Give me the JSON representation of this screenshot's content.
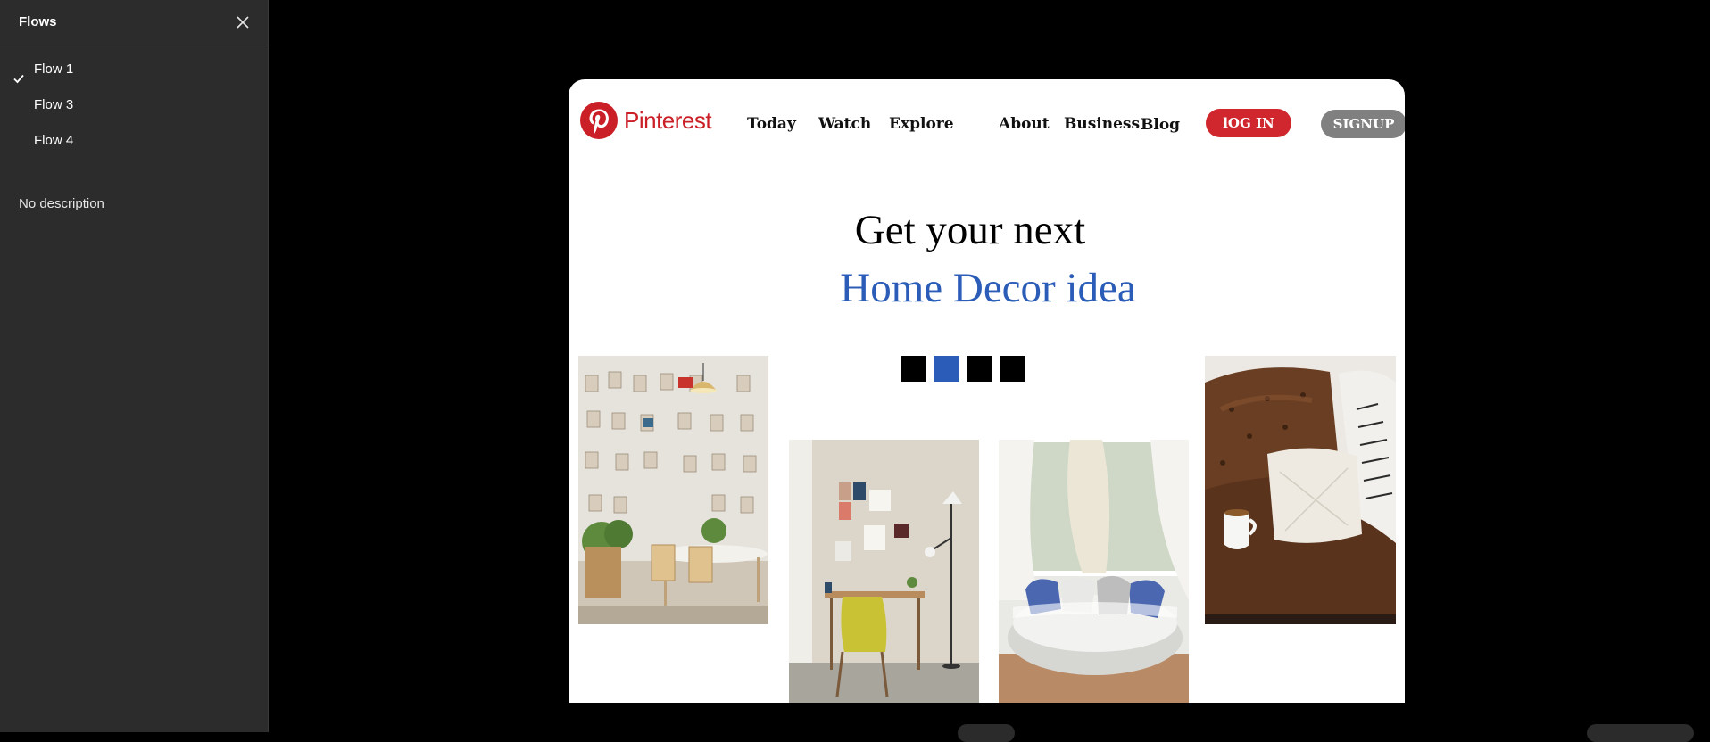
{
  "flows_panel": {
    "title": "Flows",
    "close_icon": "close-icon",
    "flows": [
      {
        "label": "Flow 1",
        "selected": true
      },
      {
        "label": "Flow 3",
        "selected": false
      },
      {
        "label": "Flow 4",
        "selected": false
      }
    ],
    "description": "No description"
  },
  "prototype": {
    "brand": {
      "name": "Pinterest",
      "color": "#cb1f27",
      "icon": "pinterest-logo-icon"
    },
    "nav": [
      "Today",
      "Watch",
      "Explore",
      "About",
      "Business",
      "Blog"
    ],
    "login_label": "lOG IN",
    "signup_label": "SIGNUP",
    "headline_line1": "Get your next",
    "headline_line2": "Home Decor idea",
    "accent_color": "#2b5cb8",
    "carousel_dots": {
      "count": 4,
      "active_index": 1
    },
    "images": [
      "wall-gallery-dining-photo",
      "yellow-chair-desk-photo",
      "round-white-sofa-photo",
      "leather-chair-pillow-photo"
    ]
  }
}
